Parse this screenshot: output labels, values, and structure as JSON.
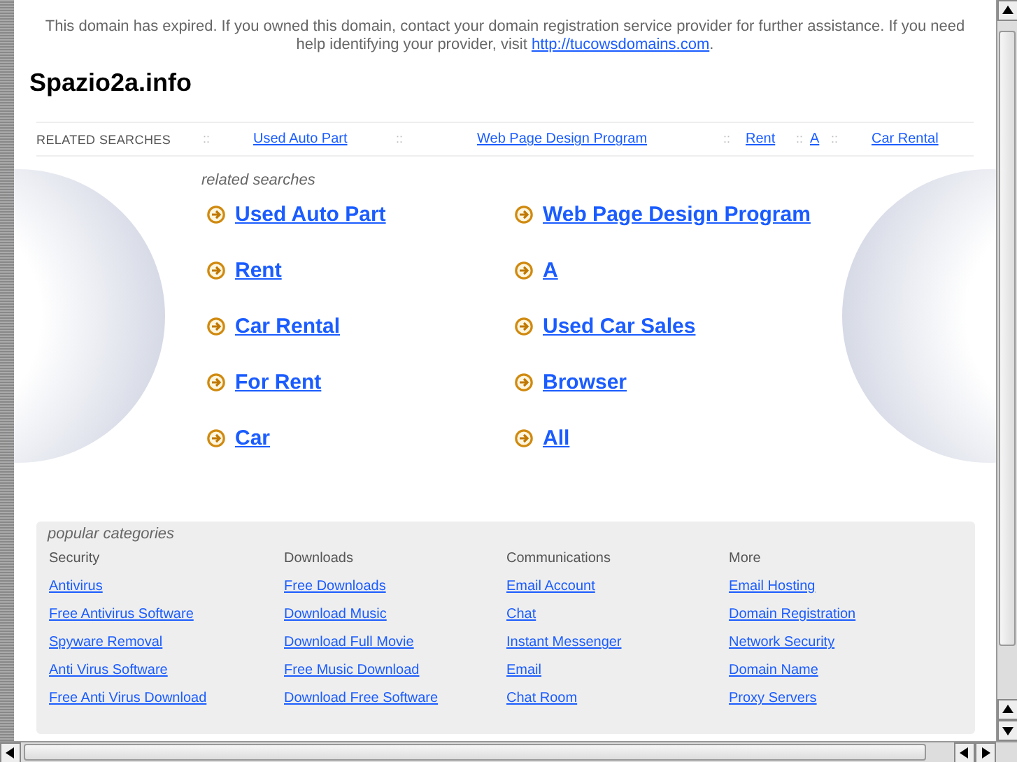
{
  "notice": {
    "text": "This domain has expired. If you owned this domain, contact your domain registration service provider for further assistance. If you need help identifying your provider, visit ",
    "link": "http://tucowsdomains.com",
    "after": "."
  },
  "site_title": "Spazio2a.info",
  "related_bar": {
    "label": "RELATED SEARCHES",
    "items": [
      {
        "kind": "separator",
        "text": "::"
      },
      {
        "kind": "link",
        "text": "Used Auto Part"
      },
      {
        "kind": "separator",
        "text": "::"
      },
      {
        "kind": "link",
        "text": "Web Page Design Program"
      },
      {
        "kind": "separator",
        "text": "::"
      },
      {
        "kind": "link",
        "text": "Rent"
      },
      {
        "kind": "separator",
        "text": "::"
      },
      {
        "kind": "link",
        "text": "A"
      },
      {
        "kind": "separator",
        "text": "::"
      },
      {
        "kind": "link",
        "text": "Car Rental"
      }
    ]
  },
  "related_searches": {
    "heading": "related searches",
    "links": [
      "Used Auto Part",
      "Web Page Design Program",
      "Rent",
      "A",
      "Car Rental",
      "Used Car Sales",
      "For Rent",
      "Browser",
      "Car",
      "All"
    ]
  },
  "popular_categories": {
    "heading": "popular categories",
    "columns": [
      {
        "title": "Security",
        "links": [
          "Antivirus",
          "Free Antivirus Software",
          "Spyware Removal",
          "Anti Virus Software",
          "Free Anti Virus Download"
        ]
      },
      {
        "title": "Downloads",
        "links": [
          "Free Downloads",
          "Download Music",
          "Download Full Movie",
          "Free Music Download",
          "Download Free Software"
        ]
      },
      {
        "title": "Communications",
        "links": [
          "Email Account",
          "Chat",
          "Instant Messenger",
          "Email",
          "Chat Room"
        ]
      },
      {
        "title": "More",
        "links": [
          "Email Hosting",
          "Domain Registration",
          "Network Security",
          "Domain Name",
          "Proxy Servers"
        ]
      }
    ]
  }
}
